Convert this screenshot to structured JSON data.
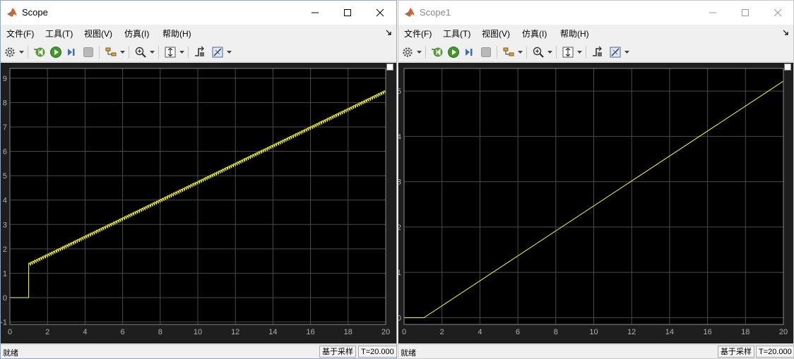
{
  "windows": [
    {
      "title": "Scope",
      "menu": [
        "文件(F)",
        "工具(T)",
        "视图(V)",
        "仿真(I)",
        "帮助(H)"
      ],
      "status": "就绪",
      "status_mode": "基于采样",
      "status_time": "T=20.000"
    },
    {
      "title": "Scope1",
      "menu": [
        "文件(F)",
        "工具(T)",
        "视图(V)",
        "仿真(I)",
        "帮助(H)"
      ],
      "status": "就绪",
      "status_mode": "基于采样",
      "status_time": "T=20.000"
    }
  ],
  "toolbar_icons": [
    "gear-icon",
    "step-back-icon",
    "run-icon",
    "step-forward-icon",
    "stop-icon",
    "highlight-icon",
    "zoom-icon",
    "autoscale-icon",
    "trigger-icon",
    "cursor-measure-icon"
  ],
  "colors": {
    "signal": "#ffff3a",
    "plot_bg": "#000000",
    "frame_bg": "#1e1e1e",
    "grid": "#4a4a4a",
    "tick_text": "#b0b0b0"
  },
  "chart_data": [
    {
      "type": "line",
      "xlim": [
        0,
        20
      ],
      "ylim": [
        -1.1,
        9.4
      ],
      "x_ticks": [
        0,
        2,
        4,
        6,
        8,
        10,
        12,
        14,
        16,
        18,
        20
      ],
      "y_ticks": [
        -1,
        0,
        1,
        2,
        3,
        4,
        5,
        6,
        7,
        8,
        9
      ],
      "grid": true,
      "series": [
        {
          "step_at": 1,
          "before": 0,
          "start": 1.35,
          "end": 8.45,
          "ripple_amplitude": 0.13,
          "ripple_period": 0.1
        }
      ]
    },
    {
      "type": "line",
      "xlim": [
        0,
        20
      ],
      "ylim": [
        -0.15,
        5.5
      ],
      "x_ticks": [
        0,
        2,
        4,
        6,
        8,
        10,
        12,
        14,
        16,
        18,
        20
      ],
      "y_ticks": [
        0,
        1,
        2,
        3,
        4,
        5
      ],
      "grid": true,
      "series": [
        {
          "x": [
            0,
            1.05,
            20
          ],
          "y": [
            0,
            0,
            5.22
          ]
        }
      ]
    }
  ]
}
